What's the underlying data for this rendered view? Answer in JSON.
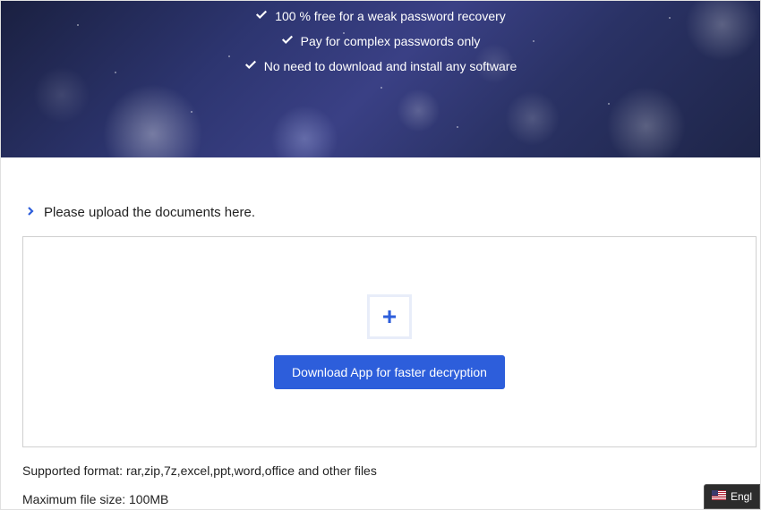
{
  "hero": {
    "features": [
      "100 % free for a weak password recovery",
      "Pay for complex passwords only",
      "No need to download and install any software"
    ]
  },
  "upload": {
    "header": "Please upload the documents here.",
    "download_button": "Download App for faster decryption"
  },
  "info": {
    "supported": "Supported format: rar,zip,7z,excel,ppt,word,office and other files",
    "maxsize": "Maximum file size: 100MB"
  },
  "lang": {
    "label": "Engl"
  }
}
